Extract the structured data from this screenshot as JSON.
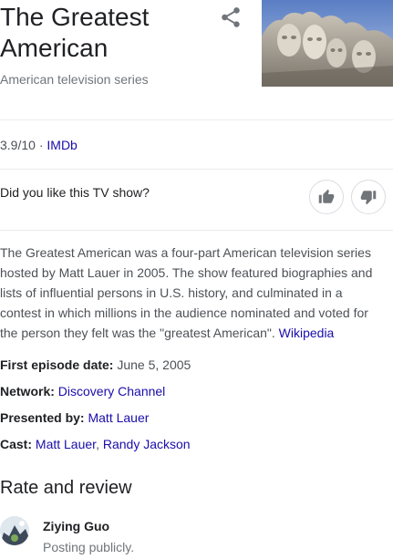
{
  "header": {
    "title": "The Greatest American",
    "subtitle": "American television series"
  },
  "rating": {
    "score": "3.9/10",
    "separator": " · ",
    "source": "IMDb"
  },
  "feedback": {
    "question": "Did you like this TV show?"
  },
  "description": {
    "text": "The Greatest American was a four-part American television series hosted by Matt Lauer in 2005. The show featured biographies and lists of influential persons in U.S. history, and culminated in a contest in which millions in the audience nominated and voted for the person they felt was the \"greatest American\". ",
    "source_link": "Wikipedia"
  },
  "facts": {
    "first_episode_label": "First episode date:",
    "first_episode_value": " June 5, 2005",
    "network_label": "Network:",
    "network_value": "Discovery Channel",
    "presented_label": "Presented by:",
    "presented_value": "Matt Lauer",
    "cast_label": "Cast:",
    "cast_1": "Matt Lauer",
    "cast_sep": ", ",
    "cast_2": "Randy Jackson"
  },
  "review": {
    "title": "Rate and review",
    "user_name": "Ziying Guo",
    "posting_status": "Posting publicly."
  },
  "icons": {
    "share": "share-icon",
    "thumbs_up": "thumbs-up-icon",
    "thumbs_down": "thumbs-down-icon"
  },
  "colors": {
    "link": "#1a0dab",
    "text": "#202124",
    "muted": "#70757a"
  }
}
